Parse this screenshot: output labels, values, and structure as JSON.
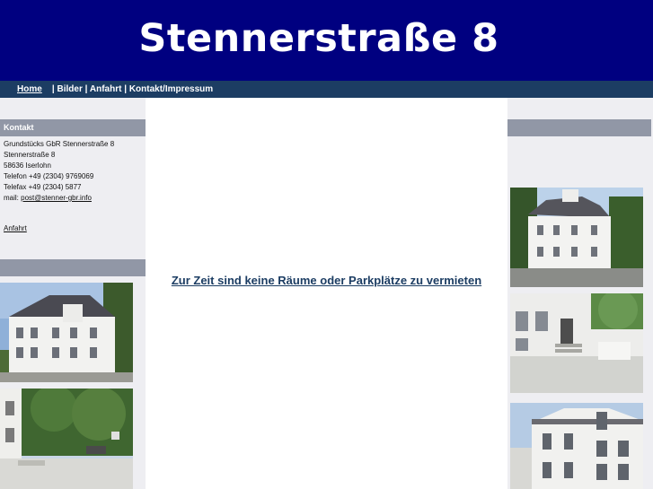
{
  "header": {
    "title": "Stennerstraße 8"
  },
  "nav": {
    "items": [
      {
        "label": "Home",
        "current": true
      },
      {
        "label": "Bilder",
        "current": false
      },
      {
        "label": "Anfahrt",
        "current": false
      },
      {
        "label": "Kontakt/Impressum",
        "current": false
      }
    ],
    "separator": " | "
  },
  "sidebar_left": {
    "contact_heading": "Kontakt",
    "contact_lines": [
      "Grundstücks GbR Stennerstraße 8",
      "Stennerstraße 8",
      "58636 Iserlohn",
      "Telefon +49 (2304) 9769069",
      "Telefax +49 (2304) 5877"
    ],
    "mail_label": "mail:",
    "mail_link": "post@stenner-gbr.info",
    "anfahrt_link": "Anfahrt",
    "gallery_heading": ""
  },
  "main": {
    "notice": "Zur Zeit sind keine Räume oder Parkplätze zu vermieten"
  },
  "sidebar_right": {
    "heading": ""
  },
  "colors": {
    "header_bg": "#000080",
    "nav_bg": "#1c3d63",
    "sidebar_bg": "#eeeef2",
    "box_heading_bg": "#9197a6",
    "notice_text": "#1c3d63"
  }
}
